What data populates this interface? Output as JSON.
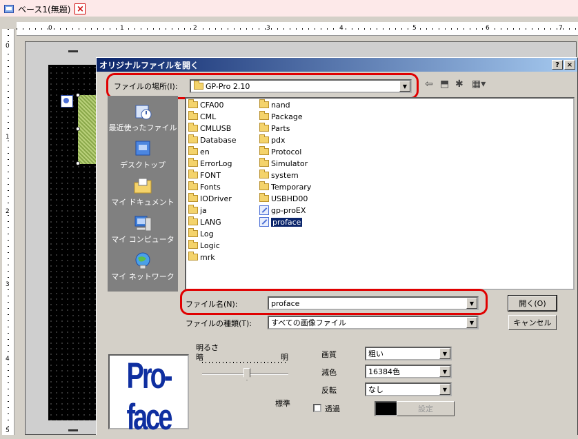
{
  "tab": {
    "title": "ベース1(無題)",
    "close_icon": "×"
  },
  "ruler": {
    "h_numbers": [
      "0",
      "1",
      "2",
      "3",
      "4",
      "5",
      "6",
      "7"
    ],
    "v_numbers": [
      "0",
      "1",
      "2",
      "3",
      "4",
      "5"
    ]
  },
  "dialog": {
    "title": "オリジナルファイルを開く",
    "help": "?",
    "close": "×",
    "location_label": "ファイルの場所(I):",
    "location_value": "GP-Pro 2.10",
    "places": [
      {
        "label": "最近使ったファイル",
        "icon": "recent-icon"
      },
      {
        "label": "デスクトップ",
        "icon": "desktop-icon"
      },
      {
        "label": "マイ ドキュメント",
        "icon": "my-documents-icon"
      },
      {
        "label": "マイ コンピュータ",
        "icon": "my-computer-icon"
      },
      {
        "label": "マイ ネットワーク",
        "icon": "my-network-icon"
      }
    ],
    "files_col1": [
      "CFA00",
      "CML",
      "CMLUSB",
      "Database",
      "en",
      "ErrorLog",
      "FONT",
      "Fonts",
      "IODriver",
      "ja",
      "LANG",
      "Log",
      "Logic",
      "mrk"
    ],
    "files_col2": [
      "nand",
      "Package",
      "Parts",
      "pdx",
      "Protocol",
      "Simulator",
      "system",
      "Temporary",
      "USBHD00"
    ],
    "files_col2_files": [
      "gp-proEX",
      "proface"
    ],
    "selected_file": "proface",
    "filename_label": "ファイル名(N):",
    "filename_value": "proface",
    "filetype_label": "ファイルの種類(T):",
    "filetype_value": "すべての画像ファイル",
    "open_button": "開く(O)",
    "cancel_button": "キャンセル",
    "preview_logo": "Pro-face",
    "brightness_label": "明るさ",
    "dark_label": "暗",
    "bright_label": "明",
    "standard_label": "標準",
    "quality_label": "画質",
    "quality_value": "粗い",
    "reduce_label": "減色",
    "reduce_value": "16384色",
    "flip_label": "反転",
    "flip_value": "なし",
    "transparent_label": "透過",
    "settings_button": "設定"
  }
}
